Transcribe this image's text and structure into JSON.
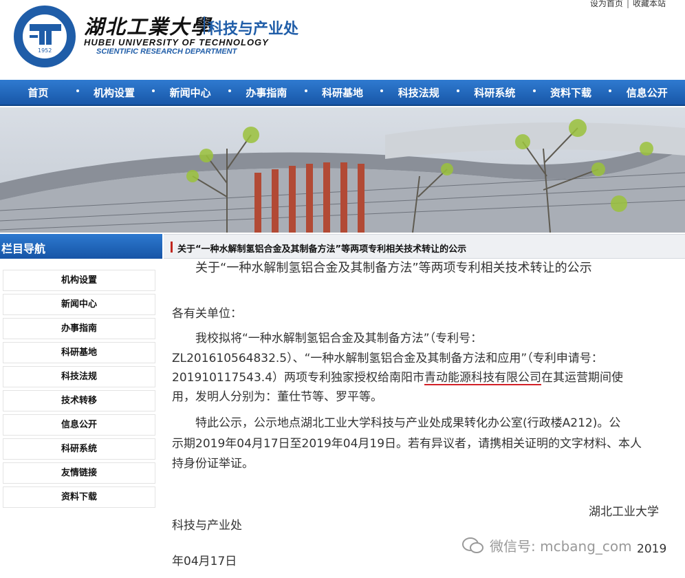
{
  "header": {
    "univ_cn": "湖北工業大學",
    "dept_cn": "科技与产业处",
    "univ_en": "HUBEI UNIVERSITY OF TECHNOLOGY",
    "dept_en": "SCIENTIFIC RESEARCH DEPARTMENT",
    "logo_year": "1952",
    "toplinks": [
      "设为首页",
      "收藏本站"
    ]
  },
  "nav": [
    "首页",
    "机构设置",
    "新闻中心",
    "办事指南",
    "科研基地",
    "科技法规",
    "科研系统",
    "资料下载",
    "信息公开"
  ],
  "sidebar": {
    "title": "栏目导航",
    "items": [
      "机构设置",
      "新闻中心",
      "办事指南",
      "科研基地",
      "科技法规",
      "技术转移",
      "信息公开",
      "科研系统",
      "友情链接",
      "资料下载"
    ]
  },
  "breadcrumb": "关于“一种水解制氢铝合金及其制备方法”等两项专利相关技术转让的公示",
  "article": {
    "title": "关于“一种水解制氢铝合金及其制备方法”等两项专利相关技术转让的公示",
    "salutation": "各有关单位：",
    "line1": "　　我校拟将“一种水解制氢铝合金及其制备方法”（专利号：",
    "line2": "ZL201610564832.5）、“一种水解制氢铝合金及其制备方法和应用”（专利申请号：",
    "line3_pre": "201910117543.4）两项专利独家授权给南阳市",
    "line3_company": "青动能源科技有限公司",
    "line3_post": "在其运营期间使",
    "line4": "用，发明人分别为：董仕节等、罗平等。",
    "line5": "　　特此公示，公示地点湖北工业大学科技与产业处成果转化办公室(行政楼A212)。公",
    "line6": "示期2019年04月17日至2019年04月19日。若有异议者，请携相关证明的文字材料、本人",
    "line7": "持身份证举证。",
    "sign1": "湖北工业大学",
    "sign2": "科技与产业处",
    "date_suffix": "2019",
    "date": "年04月17日"
  },
  "watermark": "微信号: mcbang_com",
  "colors": {
    "brand_blue": "#1f5da8",
    "accent_red": "#c0261e"
  }
}
